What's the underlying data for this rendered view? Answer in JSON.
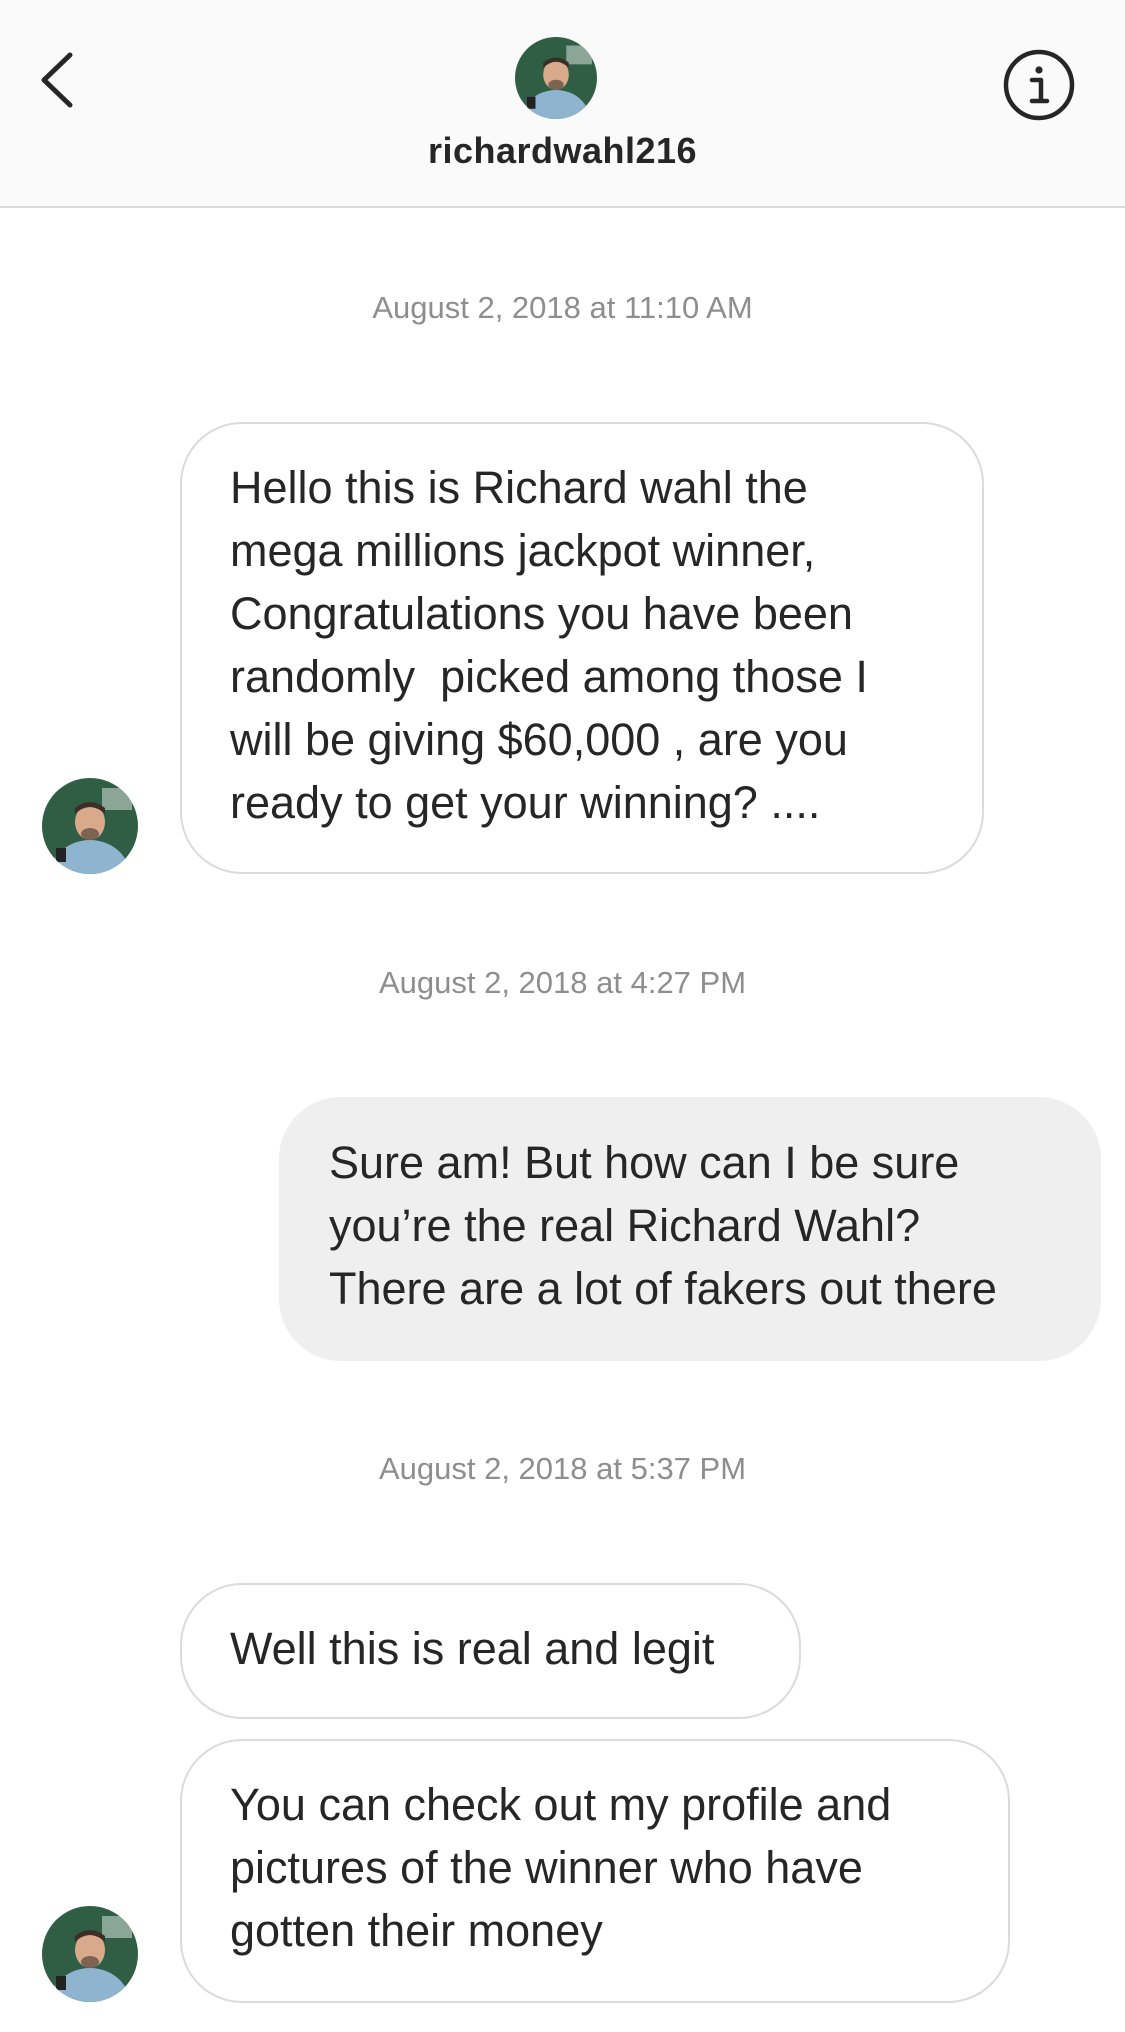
{
  "header": {
    "username": "richardwahl216",
    "back_icon": "chevron-left-icon",
    "info_icon": "info-icon"
  },
  "messages": {
    "ts1": "August 2, 2018 at 11:10 AM",
    "m1": [
      "Hello this is Richard wahl the",
      "mega millions jackpot winner,",
      "Congratulations you have been",
      "randomly  picked among those I",
      "will be giving $60,000 , are you",
      "ready to get your winning? ...."
    ],
    "ts2": "August 2, 2018 at 4:27 PM",
    "m2": [
      "Sure am! But how can I be sure",
      "you’re the real Richard Wahl?",
      "There are a lot of fakers out there"
    ],
    "ts3": "August 2, 2018 at 5:37 PM",
    "m3": [
      "Well this is real and legit"
    ],
    "m4": [
      "You can check out my profile and",
      "pictures of the winner who have",
      "gotten their money"
    ]
  },
  "colors": {
    "header_bg": "#fafafa",
    "incoming_border": "#dbdbdb",
    "outgoing_bg": "#efefef",
    "timestamp": "#8e8e8e",
    "text": "#262626"
  }
}
